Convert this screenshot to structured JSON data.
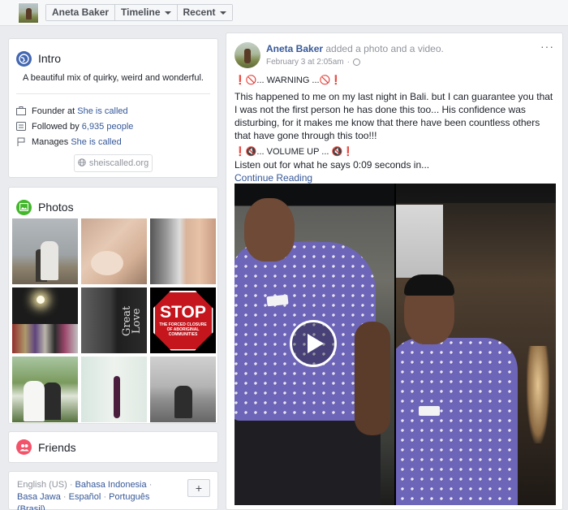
{
  "header": {
    "profile_name": "Aneta Baker",
    "timeline_label": "Timeline",
    "recent_label": "Recent"
  },
  "intro": {
    "title": "Intro",
    "description": "A beautiful mix of quirky, weird and wonderful.",
    "founder_prefix": "Founder at",
    "founder_link": "She is called",
    "followed_prefix": "Followed by",
    "followed_link": "6,935 people",
    "manages_prefix": "Manages",
    "manages_link": "She is called",
    "website": "sheiscalled.org"
  },
  "photos": {
    "title": "Photos",
    "tiles": [
      {
        "icon": "photo-couple-field"
      },
      {
        "icon": "photo-mother-baby"
      },
      {
        "icon": "photo-selfie"
      },
      {
        "icon": "photo-stage-group"
      },
      {
        "icon": "photo-great-love-poster",
        "text": "Great Love"
      },
      {
        "icon": "photo-stop-sign",
        "big": "STOP",
        "small": "THE FORCED CLOSURE OF ABORIGINAL COMMUNITIES"
      },
      {
        "icon": "photo-wedding"
      },
      {
        "icon": "photo-woman-dress"
      },
      {
        "icon": "photo-couple-beach"
      }
    ]
  },
  "friends": {
    "title": "Friends"
  },
  "languages": {
    "current": "English (US)",
    "options": [
      "Bahasa Indonesia",
      "Basa Jawa",
      "Español",
      "Português (Brasil)"
    ],
    "add_label": "+"
  },
  "post": {
    "author": "Aneta Baker",
    "action": "added a photo and a video.",
    "date": "February 3 at 2:05am",
    "date_sep": "·",
    "more_label": "···",
    "warning_line": "❗🚫... WARNING ...🚫❗",
    "body_text": "This happened to me on my last night in Bali. but I can guarantee you that I was not the first person he has done this too... His confidence was disturbing, for it makes me know that there have been countless others that have gone through this too!!!",
    "volume_line": "❗🔇... VOLUME UP ... 🔇❗",
    "listen_line": "Listen out for what he says 0:09 seconds in...",
    "continue_label": "Continue Reading"
  },
  "colors": {
    "link": "#365899",
    "background": "#e9ebee",
    "intro_icon": "#4267b2",
    "photos_icon": "#42b72a",
    "friends_icon": "#f35369"
  }
}
